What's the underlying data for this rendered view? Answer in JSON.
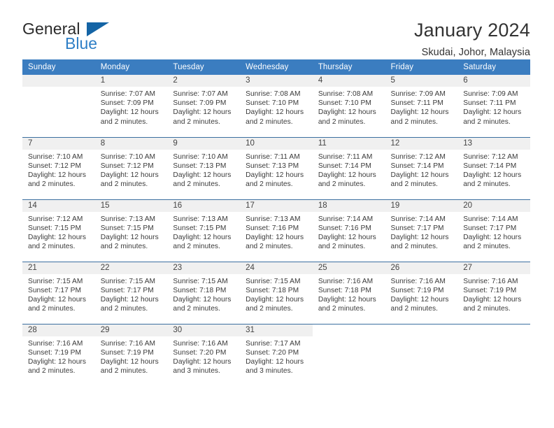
{
  "logo": {
    "word_top": "General",
    "word_bottom": "Blue",
    "triangle_color": "#1464a5",
    "blue_color": "#2f7fc6"
  },
  "header": {
    "title": "January 2024",
    "subtitle": "Skudai, Johor, Malaysia"
  },
  "theme": {
    "header_bg": "#3b7dc0",
    "row_divider": "#3b6fa0",
    "daynum_bg": "#f0f0f0",
    "text": "#3a3a3a"
  },
  "weekdays": [
    "Sunday",
    "Monday",
    "Tuesday",
    "Wednesday",
    "Thursday",
    "Friday",
    "Saturday"
  ],
  "labels": {
    "sunrise": "Sunrise:",
    "sunset": "Sunset:",
    "daylight": "Daylight:"
  },
  "weeks": [
    [
      {
        "day": "",
        "sunrise": "",
        "sunset": "",
        "daylight": "",
        "daylight2": ""
      },
      {
        "day": "1",
        "sunrise": "Sunrise: 7:07 AM",
        "sunset": "Sunset: 7:09 PM",
        "daylight": "Daylight: 12 hours",
        "daylight2": "and 2 minutes."
      },
      {
        "day": "2",
        "sunrise": "Sunrise: 7:07 AM",
        "sunset": "Sunset: 7:09 PM",
        "daylight": "Daylight: 12 hours",
        "daylight2": "and 2 minutes."
      },
      {
        "day": "3",
        "sunrise": "Sunrise: 7:08 AM",
        "sunset": "Sunset: 7:10 PM",
        "daylight": "Daylight: 12 hours",
        "daylight2": "and 2 minutes."
      },
      {
        "day": "4",
        "sunrise": "Sunrise: 7:08 AM",
        "sunset": "Sunset: 7:10 PM",
        "daylight": "Daylight: 12 hours",
        "daylight2": "and 2 minutes."
      },
      {
        "day": "5",
        "sunrise": "Sunrise: 7:09 AM",
        "sunset": "Sunset: 7:11 PM",
        "daylight": "Daylight: 12 hours",
        "daylight2": "and 2 minutes."
      },
      {
        "day": "6",
        "sunrise": "Sunrise: 7:09 AM",
        "sunset": "Sunset: 7:11 PM",
        "daylight": "Daylight: 12 hours",
        "daylight2": "and 2 minutes."
      }
    ],
    [
      {
        "day": "7",
        "sunrise": "Sunrise: 7:10 AM",
        "sunset": "Sunset: 7:12 PM",
        "daylight": "Daylight: 12 hours",
        "daylight2": "and 2 minutes."
      },
      {
        "day": "8",
        "sunrise": "Sunrise: 7:10 AM",
        "sunset": "Sunset: 7:12 PM",
        "daylight": "Daylight: 12 hours",
        "daylight2": "and 2 minutes."
      },
      {
        "day": "9",
        "sunrise": "Sunrise: 7:10 AM",
        "sunset": "Sunset: 7:13 PM",
        "daylight": "Daylight: 12 hours",
        "daylight2": "and 2 minutes."
      },
      {
        "day": "10",
        "sunrise": "Sunrise: 7:11 AM",
        "sunset": "Sunset: 7:13 PM",
        "daylight": "Daylight: 12 hours",
        "daylight2": "and 2 minutes."
      },
      {
        "day": "11",
        "sunrise": "Sunrise: 7:11 AM",
        "sunset": "Sunset: 7:14 PM",
        "daylight": "Daylight: 12 hours",
        "daylight2": "and 2 minutes."
      },
      {
        "day": "12",
        "sunrise": "Sunrise: 7:12 AM",
        "sunset": "Sunset: 7:14 PM",
        "daylight": "Daylight: 12 hours",
        "daylight2": "and 2 minutes."
      },
      {
        "day": "13",
        "sunrise": "Sunrise: 7:12 AM",
        "sunset": "Sunset: 7:14 PM",
        "daylight": "Daylight: 12 hours",
        "daylight2": "and 2 minutes."
      }
    ],
    [
      {
        "day": "14",
        "sunrise": "Sunrise: 7:12 AM",
        "sunset": "Sunset: 7:15 PM",
        "daylight": "Daylight: 12 hours",
        "daylight2": "and 2 minutes."
      },
      {
        "day": "15",
        "sunrise": "Sunrise: 7:13 AM",
        "sunset": "Sunset: 7:15 PM",
        "daylight": "Daylight: 12 hours",
        "daylight2": "and 2 minutes."
      },
      {
        "day": "16",
        "sunrise": "Sunrise: 7:13 AM",
        "sunset": "Sunset: 7:15 PM",
        "daylight": "Daylight: 12 hours",
        "daylight2": "and 2 minutes."
      },
      {
        "day": "17",
        "sunrise": "Sunrise: 7:13 AM",
        "sunset": "Sunset: 7:16 PM",
        "daylight": "Daylight: 12 hours",
        "daylight2": "and 2 minutes."
      },
      {
        "day": "18",
        "sunrise": "Sunrise: 7:14 AM",
        "sunset": "Sunset: 7:16 PM",
        "daylight": "Daylight: 12 hours",
        "daylight2": "and 2 minutes."
      },
      {
        "day": "19",
        "sunrise": "Sunrise: 7:14 AM",
        "sunset": "Sunset: 7:17 PM",
        "daylight": "Daylight: 12 hours",
        "daylight2": "and 2 minutes."
      },
      {
        "day": "20",
        "sunrise": "Sunrise: 7:14 AM",
        "sunset": "Sunset: 7:17 PM",
        "daylight": "Daylight: 12 hours",
        "daylight2": "and 2 minutes."
      }
    ],
    [
      {
        "day": "21",
        "sunrise": "Sunrise: 7:15 AM",
        "sunset": "Sunset: 7:17 PM",
        "daylight": "Daylight: 12 hours",
        "daylight2": "and 2 minutes."
      },
      {
        "day": "22",
        "sunrise": "Sunrise: 7:15 AM",
        "sunset": "Sunset: 7:17 PM",
        "daylight": "Daylight: 12 hours",
        "daylight2": "and 2 minutes."
      },
      {
        "day": "23",
        "sunrise": "Sunrise: 7:15 AM",
        "sunset": "Sunset: 7:18 PM",
        "daylight": "Daylight: 12 hours",
        "daylight2": "and 2 minutes."
      },
      {
        "day": "24",
        "sunrise": "Sunrise: 7:15 AM",
        "sunset": "Sunset: 7:18 PM",
        "daylight": "Daylight: 12 hours",
        "daylight2": "and 2 minutes."
      },
      {
        "day": "25",
        "sunrise": "Sunrise: 7:16 AM",
        "sunset": "Sunset: 7:18 PM",
        "daylight": "Daylight: 12 hours",
        "daylight2": "and 2 minutes."
      },
      {
        "day": "26",
        "sunrise": "Sunrise: 7:16 AM",
        "sunset": "Sunset: 7:19 PM",
        "daylight": "Daylight: 12 hours",
        "daylight2": "and 2 minutes."
      },
      {
        "day": "27",
        "sunrise": "Sunrise: 7:16 AM",
        "sunset": "Sunset: 7:19 PM",
        "daylight": "Daylight: 12 hours",
        "daylight2": "and 2 minutes."
      }
    ],
    [
      {
        "day": "28",
        "sunrise": "Sunrise: 7:16 AM",
        "sunset": "Sunset: 7:19 PM",
        "daylight": "Daylight: 12 hours",
        "daylight2": "and 2 minutes."
      },
      {
        "day": "29",
        "sunrise": "Sunrise: 7:16 AM",
        "sunset": "Sunset: 7:19 PM",
        "daylight": "Daylight: 12 hours",
        "daylight2": "and 2 minutes."
      },
      {
        "day": "30",
        "sunrise": "Sunrise: 7:16 AM",
        "sunset": "Sunset: 7:20 PM",
        "daylight": "Daylight: 12 hours",
        "daylight2": "and 3 minutes."
      },
      {
        "day": "31",
        "sunrise": "Sunrise: 7:17 AM",
        "sunset": "Sunset: 7:20 PM",
        "daylight": "Daylight: 12 hours",
        "daylight2": "and 3 minutes."
      },
      {
        "day": "",
        "sunrise": "",
        "sunset": "",
        "daylight": "",
        "daylight2": ""
      },
      {
        "day": "",
        "sunrise": "",
        "sunset": "",
        "daylight": "",
        "daylight2": ""
      },
      {
        "day": "",
        "sunrise": "",
        "sunset": "",
        "daylight": "",
        "daylight2": ""
      }
    ]
  ]
}
